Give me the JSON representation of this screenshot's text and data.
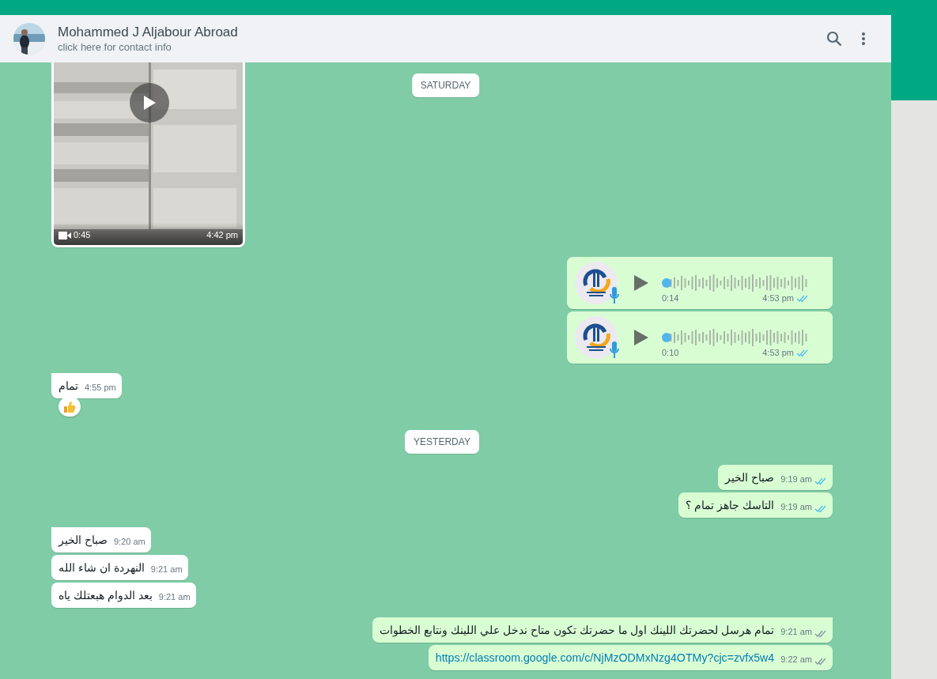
{
  "header": {
    "name": "Mohammed J Aljabour Abroad",
    "subtitle": "click here for contact info"
  },
  "floating_date": "SATURDAY",
  "messages": [
    {
      "kind": "video",
      "outgoing": false,
      "duration": "0:45",
      "time": "4:42 pm"
    },
    {
      "kind": "voice",
      "outgoing": true,
      "duration": "0:14",
      "time": "4:53 pm",
      "read": true
    },
    {
      "kind": "voice",
      "outgoing": true,
      "duration": "0:10",
      "time": "4:53 pm",
      "read": true
    },
    {
      "kind": "text",
      "outgoing": false,
      "text": "تمام",
      "time": "4:55 pm",
      "reaction": {
        "kind": "thumbs"
      }
    },
    {
      "kind": "date",
      "text": "YESTERDAY"
    },
    {
      "kind": "text",
      "outgoing": true,
      "text": "صباح الخير",
      "time": "9:19 am",
      "read": true
    },
    {
      "kind": "text",
      "outgoing": true,
      "text": "التاسك جاهز تمام ؟",
      "time": "9:19 am",
      "read": true
    },
    {
      "kind": "text",
      "outgoing": false,
      "text": "صباح الخير",
      "time": "9:20 am"
    },
    {
      "kind": "text",
      "outgoing": false,
      "text": "النهردة ان شاء الله",
      "time": "9:21 am"
    },
    {
      "kind": "text",
      "outgoing": false,
      "text": "بعد الدوام هبعتلك ياه",
      "time": "9:21 am"
    },
    {
      "kind": "text",
      "outgoing": true,
      "text": "تمام هرسل لحضرتك اللينك اول ما حضرتك تكون متاح ندخل علي اللينك ونتابع الخطوات",
      "time": "9:21 am",
      "read": false
    },
    {
      "kind": "link",
      "outgoing": true,
      "text": "https://classroom.google.com/c/NjMzODMxNzg4OTMy?cjc=zvfx5w4",
      "time": "9:22 am",
      "read": false
    }
  ]
}
